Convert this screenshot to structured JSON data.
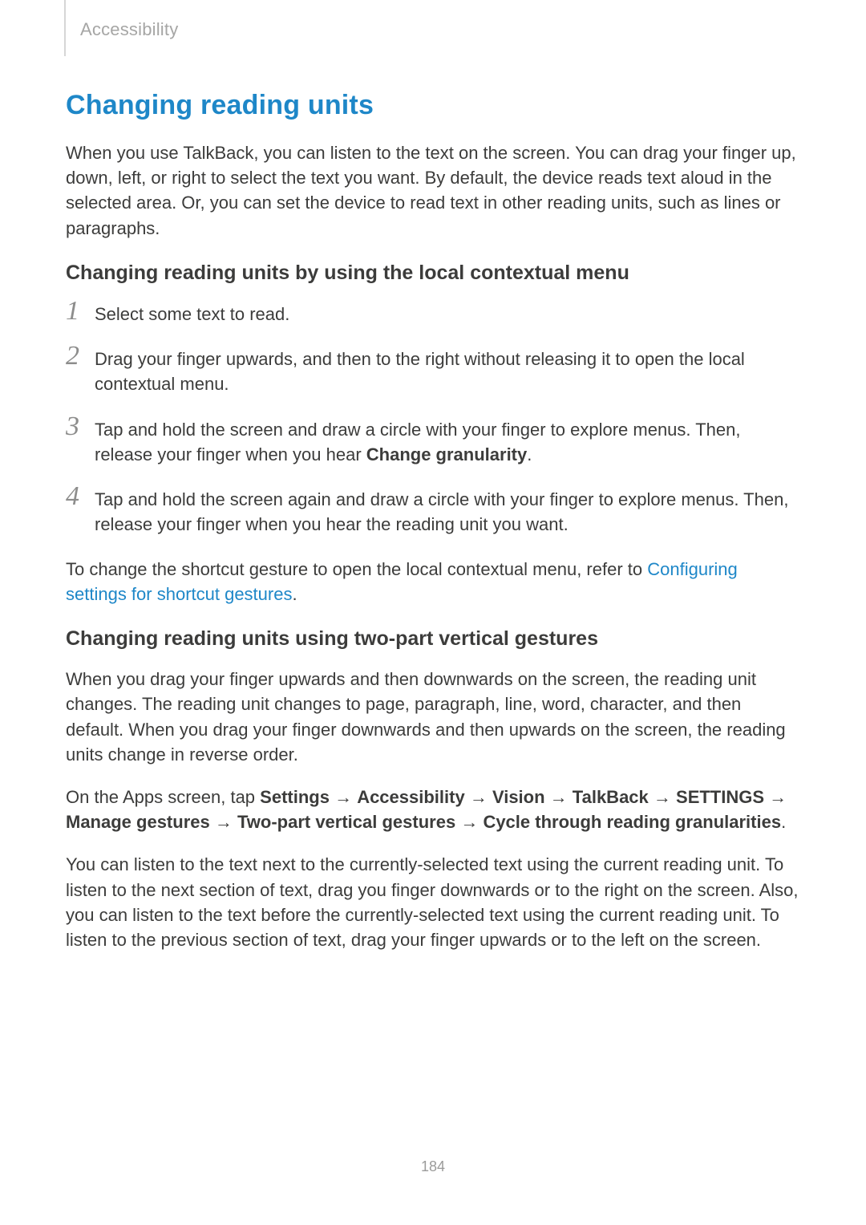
{
  "header": {
    "section_label": "Accessibility"
  },
  "h2": "Changing reading units",
  "intro": "When you use TalkBack, you can listen to the text on the screen. You can drag your finger up, down, left, or right to select the text you want. By default, the device reads text aloud in the selected area. Or, you can set the device to read text in other reading units, such as lines or paragraphs.",
  "section1": {
    "heading": "Changing reading units by using the local contextual menu",
    "steps": {
      "s1": {
        "num": "1",
        "text": "Select some text to read."
      },
      "s2": {
        "num": "2",
        "text": "Drag your finger upwards, and then to the right without releasing it to open the local contextual menu."
      },
      "s3": {
        "num": "3",
        "pre": "Tap and hold the screen and draw a circle with your finger to explore menus. Then, release your finger when you hear ",
        "bold": "Change granularity",
        "post": "."
      },
      "s4": {
        "num": "4",
        "text": "Tap and hold the screen again and draw a circle with your finger to explore menus. Then, release your finger when you hear the reading unit you want."
      }
    },
    "note_pre": "To change the shortcut gesture to open the local contextual menu, refer to ",
    "note_link": "Configuring settings for shortcut gestures",
    "note_post": "."
  },
  "section2": {
    "heading": "Changing reading units using two-part vertical gestures",
    "p1": "When you drag your finger upwards and then downwards on the screen, the reading unit changes. The reading unit changes to page, paragraph, line, word, character, and then default. When you drag your finger downwards and then upwards on the screen, the reading units change in reverse order.",
    "path": {
      "pre": "On the Apps screen, tap ",
      "parts": [
        "Settings",
        "Accessibility",
        "Vision",
        "TalkBack",
        "SETTINGS",
        "Manage gestures",
        "Two-part vertical gestures",
        "Cycle through reading granularities"
      ],
      "arrow": " → ",
      "post": "."
    },
    "p3": "You can listen to the text next to the currently-selected text using the current reading unit. To listen to the next section of text, drag you finger downwards or to the right on the screen. Also, you can listen to the text before the currently-selected text using the current reading unit. To listen to the previous section of text, drag your finger upwards or to the left on the screen."
  },
  "page_number": "184"
}
